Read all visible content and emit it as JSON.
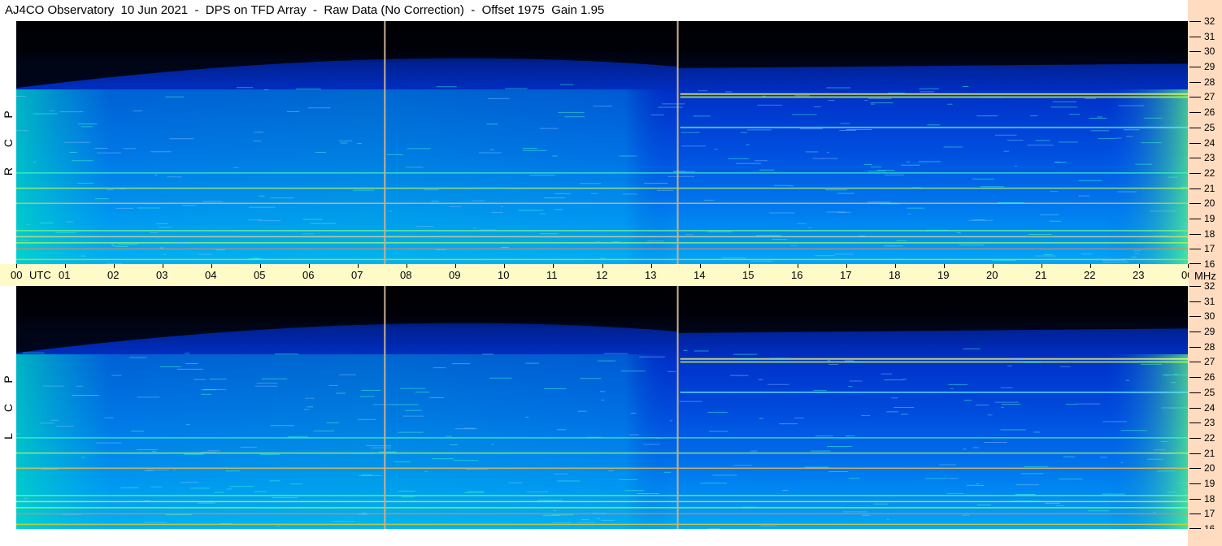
{
  "header": {
    "title": "AJ4CO Observatory  10 Jun 2021  -  DPS on TFD Array  -  Raw Data (No Correction)  -  Offset 1975  Gain 1.95"
  },
  "time_axis": {
    "utc_label": "UTC",
    "mhz_label": "MHz",
    "ticks": [
      "00",
      "01",
      "02",
      "03",
      "04",
      "05",
      "06",
      "07",
      "08",
      "09",
      "10",
      "11",
      "12",
      "13",
      "14",
      "15",
      "16",
      "17",
      "18",
      "19",
      "20",
      "21",
      "22",
      "23",
      "00"
    ]
  },
  "panels": [
    {
      "id": "rcp",
      "polarization_letters": [
        "R",
        "C",
        "P"
      ]
    },
    {
      "id": "lcp",
      "polarization_letters": [
        "L",
        "C",
        "P"
      ]
    }
  ],
  "chart_data": [
    {
      "type": "heatmap",
      "title": "AJ4CO Observatory  10 Jun 2021  -  DPS on TFD Array  -  Raw Data (No Correction)  -  Offset 1975  Gain 1.95",
      "panel": "RCP",
      "x": {
        "label": "UTC",
        "range": [
          0,
          24
        ],
        "ticks": [
          "00",
          "01",
          "02",
          "03",
          "04",
          "05",
          "06",
          "07",
          "08",
          "09",
          "10",
          "11",
          "12",
          "13",
          "14",
          "15",
          "16",
          "17",
          "18",
          "19",
          "20",
          "21",
          "22",
          "23",
          "00"
        ]
      },
      "y": {
        "label": "MHz",
        "range": [
          16,
          32
        ],
        "ticks": [
          16,
          17,
          18,
          19,
          20,
          21,
          22,
          23,
          24,
          25,
          26,
          27,
          28,
          29,
          30,
          31,
          32
        ]
      },
      "colormap": [
        "#000000",
        "#00007f",
        "#0000ff",
        "#0070ff",
        "#00c8ff",
        "#40ffc0",
        "#c0ff40",
        "#ffa000",
        "#ff0000"
      ],
      "vertical_markers_utc": [
        7.55,
        13.55
      ],
      "interference_bands_mhz": [
        16.3,
        17.0,
        17.4,
        17.8,
        18.2,
        20.0,
        21.0,
        22.0,
        25.0,
        27.0,
        27.2
      ]
    },
    {
      "type": "heatmap",
      "panel": "LCP",
      "x": {
        "label": "UTC",
        "range": [
          0,
          24
        ],
        "ticks": [
          "00",
          "01",
          "02",
          "03",
          "04",
          "05",
          "06",
          "07",
          "08",
          "09",
          "10",
          "11",
          "12",
          "13",
          "14",
          "15",
          "16",
          "17",
          "18",
          "19",
          "20",
          "21",
          "22",
          "23",
          "00"
        ]
      },
      "y": {
        "label": "MHz",
        "range": [
          16,
          32
        ],
        "ticks": [
          16,
          17,
          18,
          19,
          20,
          21,
          22,
          23,
          24,
          25,
          26,
          27,
          28,
          29,
          30,
          31,
          32
        ]
      },
      "colormap": [
        "#000000",
        "#00007f",
        "#0000ff",
        "#0070ff",
        "#00c8ff",
        "#40ffc0",
        "#c0ff40",
        "#ffa000",
        "#ff0000"
      ],
      "vertical_markers_utc": [
        7.55,
        13.55
      ],
      "interference_bands_mhz": [
        16.3,
        17.0,
        17.4,
        17.8,
        18.2,
        20.0,
        21.0,
        22.0,
        25.0,
        27.0,
        27.2
      ]
    }
  ]
}
